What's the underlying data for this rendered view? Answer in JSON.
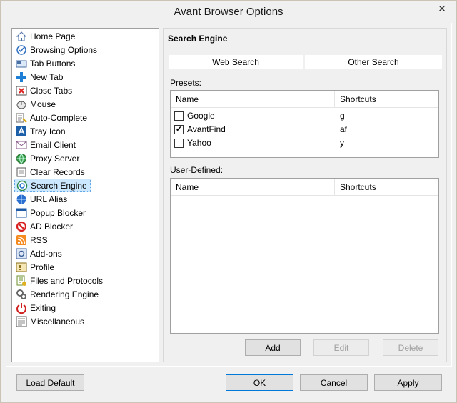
{
  "window": {
    "title": "Avant Browser Options",
    "close_glyph": "✕"
  },
  "nav": {
    "items": [
      {
        "label": "Home Page",
        "icon": "home-icon"
      },
      {
        "label": "Browsing Options",
        "icon": "browsing-options-icon"
      },
      {
        "label": "Tab Buttons",
        "icon": "tab-buttons-icon"
      },
      {
        "label": "New Tab",
        "icon": "plus-icon"
      },
      {
        "label": "Close Tabs",
        "icon": "close-tabs-icon"
      },
      {
        "label": "Mouse",
        "icon": "mouse-icon"
      },
      {
        "label": "Auto-Complete",
        "icon": "auto-complete-icon"
      },
      {
        "label": "Tray Icon",
        "icon": "tray-icon"
      },
      {
        "label": "Email Client",
        "icon": "envelope-icon"
      },
      {
        "label": "Proxy Server",
        "icon": "globe-icon"
      },
      {
        "label": "Clear Records",
        "icon": "clear-records-icon"
      },
      {
        "label": "Search Engine",
        "icon": "search-engine-icon"
      },
      {
        "label": "URL Alias",
        "icon": "url-alias-icon"
      },
      {
        "label": "Popup Blocker",
        "icon": "popup-blocker-icon"
      },
      {
        "label": "AD Blocker",
        "icon": "no-entry-icon"
      },
      {
        "label": "RSS",
        "icon": "rss-icon"
      },
      {
        "label": "Add-ons",
        "icon": "add-ons-icon"
      },
      {
        "label": "Profile",
        "icon": "profile-icon"
      },
      {
        "label": "Files and Protocols",
        "icon": "files-icon"
      },
      {
        "label": "Rendering Engine",
        "icon": "gears-icon"
      },
      {
        "label": "Exiting",
        "icon": "power-icon"
      },
      {
        "label": "Miscellaneous",
        "icon": "misc-icon"
      }
    ],
    "selected": "Search Engine"
  },
  "main": {
    "section_title": "Search Engine",
    "tabs": [
      {
        "label": "Web Search",
        "active": true
      },
      {
        "label": "Other Search",
        "active": false
      }
    ],
    "presets": {
      "label": "Presets:",
      "columns": [
        "Name",
        "Shortcuts"
      ],
      "rows": [
        {
          "name": "Google",
          "shortcut": "g",
          "checked": false
        },
        {
          "name": "AvantFind",
          "shortcut": "af",
          "checked": true
        },
        {
          "name": "Yahoo",
          "shortcut": "y",
          "checked": false
        }
      ]
    },
    "user_defined": {
      "label": "User-Defined:",
      "columns": [
        "Name",
        "Shortcuts"
      ],
      "rows": []
    },
    "buttons": {
      "add": "Add",
      "edit": "Edit",
      "delete": "Delete"
    }
  },
  "footer": {
    "load_default": "Load Default",
    "ok": "OK",
    "cancel": "Cancel",
    "apply": "Apply"
  },
  "colors": {
    "selection": "#cce8ff",
    "accent": "#0078d7"
  }
}
